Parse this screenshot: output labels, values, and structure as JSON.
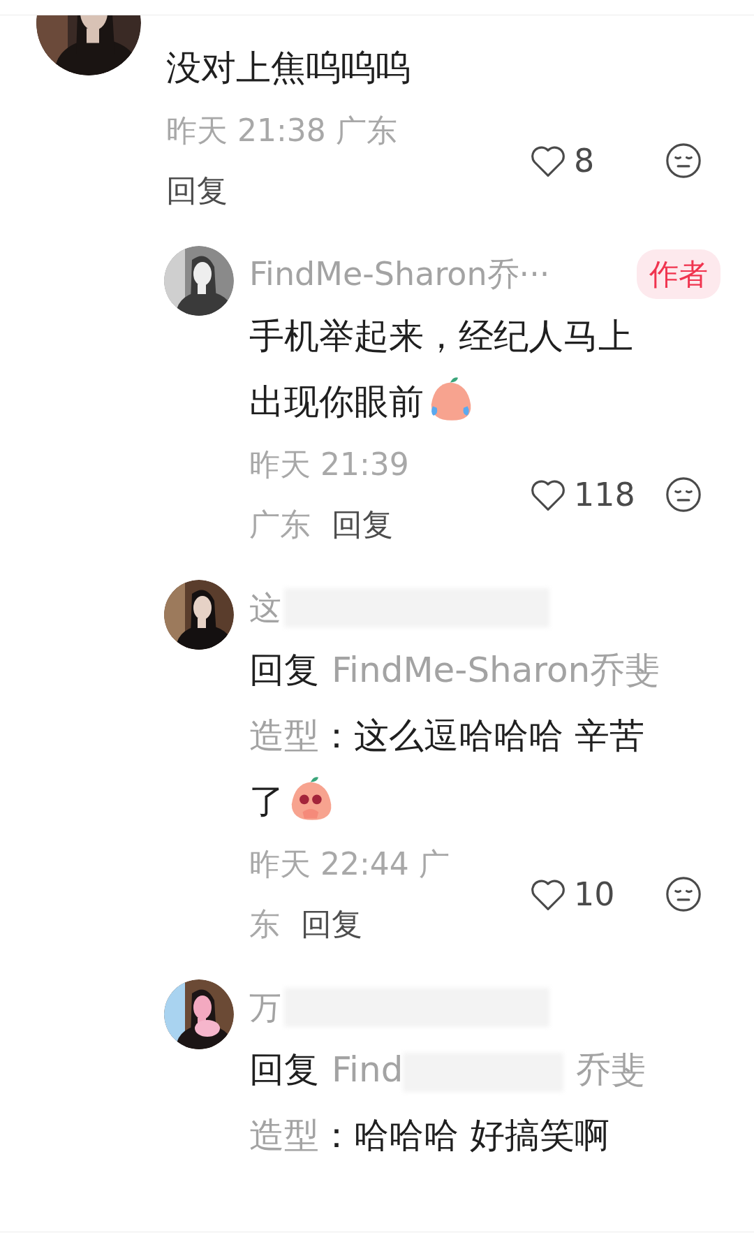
{
  "comments": [
    {
      "kind": "comment",
      "avatar": {
        "kind": "picture"
      },
      "lines": [
        [
          {
            "kind": "plain",
            "t": "没对上焦呜呜呜"
          }
        ]
      ],
      "meta_lines": [
        [
          {
            "kind": "info",
            "t": "昨天 21:38 广东"
          }
        ],
        [
          {
            "kind": "reply",
            "t": "回复"
          }
        ]
      ],
      "likes": "8",
      "liked": false
    },
    {
      "kind": "reply",
      "avatar": {
        "kind": "picture"
      },
      "name_parts": [
        {
          "kind": "text",
          "t": "FindMe-Sharon乔···"
        }
      ],
      "badge": "作者",
      "lines": [
        [
          {
            "kind": "plain",
            "t": "手机举起来，经纪人马上"
          }
        ],
        [
          {
            "kind": "plain",
            "t": "出现你眼前"
          },
          {
            "kind": "crying_emoji"
          }
        ]
      ],
      "meta_lines": [
        [
          {
            "kind": "info",
            "t": "昨天 21:39"
          }
        ],
        [
          {
            "kind": "info",
            "t": "广东"
          },
          {
            "kind": "reply",
            "t": "回复"
          }
        ]
      ],
      "likes": "118",
      "liked": false
    },
    {
      "kind": "reply",
      "avatar": {
        "kind": "picture"
      },
      "name_parts": [
        {
          "kind": "text",
          "t": "这"
        },
        {
          "kind": "blur"
        }
      ],
      "lines": [
        [
          {
            "kind": "plain",
            "t": "回复"
          },
          {
            "kind": "mention",
            "t": "FindMe-Sharon乔斐"
          }
        ],
        [
          {
            "kind": "mention",
            "t": "造型"
          },
          {
            "kind": "plain",
            "t": "：这么逗哈哈哈 辛苦"
          }
        ],
        [
          {
            "kind": "plain",
            "t": "了"
          },
          {
            "kind": "pleading_emoji"
          }
        ]
      ],
      "meta_lines": [
        [
          {
            "kind": "info",
            "t": "昨天 22:44 广"
          }
        ],
        [
          {
            "kind": "info",
            "t": "东"
          },
          {
            "kind": "reply",
            "t": "回复"
          }
        ]
      ],
      "likes": "10",
      "liked": false
    },
    {
      "kind": "reply",
      "avatar": {
        "kind": "picture"
      },
      "name_parts": [
        {
          "kind": "text",
          "t": "万"
        },
        {
          "kind": "blur"
        }
      ],
      "lines": [
        [
          {
            "kind": "plain",
            "t": "回复"
          },
          {
            "kind": "mention",
            "t": "Find"
          },
          {
            "kind": "blur"
          },
          {
            "kind": "mention",
            "t": "乔斐"
          }
        ],
        [
          {
            "kind": "mention",
            "t": "造型"
          },
          {
            "kind": "plain",
            "t": "：哈哈哈 好搞笑啊"
          }
        ]
      ]
    }
  ]
}
